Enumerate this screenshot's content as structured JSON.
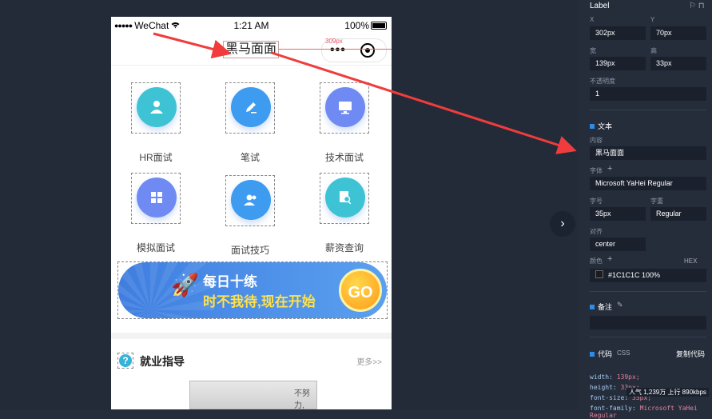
{
  "statusbar": {
    "carrier": "WeChat",
    "time": "1:21 AM",
    "battery": "100%"
  },
  "navbar": {
    "title": "黑马面面",
    "more": "•••",
    "measure": "309px"
  },
  "grid": {
    "items": [
      {
        "label": "HR面试",
        "icon": "user-icon",
        "color": "#3ec3d5"
      },
      {
        "label": "笔试",
        "icon": "pen-icon",
        "color": "#3d9bf0"
      },
      {
        "label": "技术面试",
        "icon": "monitor-icon",
        "color": "#6f8af2"
      },
      {
        "label": "模拟面试",
        "icon": "grid-icon",
        "color": "#6f8af2"
      },
      {
        "label": "面试技巧",
        "icon": "people-icon",
        "color": "#3d9bf0"
      },
      {
        "label": "薪资查询",
        "icon": "search-doc-icon",
        "color": "#3ec3d5"
      }
    ]
  },
  "banner": {
    "line1": "每日十练",
    "line2": "时不我待,现在开始",
    "go": "GO"
  },
  "section": {
    "title": "就业指导",
    "more": "更多>>",
    "photo_text": "不努力,"
  },
  "panel": {
    "title": "Label",
    "x_label": "X",
    "x_value": "302px",
    "y_label": "Y",
    "y_value": "70px",
    "w_label": "宽",
    "w_value": "139px",
    "h_label": "高",
    "h_value": "33px",
    "opacity_label": "不透明度",
    "opacity_value": "1",
    "text_section": "文本",
    "content_label": "内容",
    "content_value": "黑马面面",
    "font_label": "字体",
    "font_value": "Microsoft YaHei Regular",
    "size_label": "字号",
    "size_value": "35px",
    "weight_label": "字重",
    "weight_value": "Regular",
    "align_label": "对齐",
    "align_value": "center",
    "color_label": "颜色",
    "color_format": "HEX",
    "color_value": "#1C1C1C  100%",
    "note_section": "备注",
    "code_section": "代码",
    "code_lang": "CSS",
    "copy_code": "复制代码",
    "code_lines": [
      {
        "prop": "width:",
        "val": "139px;"
      },
      {
        "prop": "height:",
        "val": "33px;"
      },
      {
        "prop": "font-size:",
        "val": "35px;"
      },
      {
        "prop": "font-family:",
        "val": "Microsoft YaHei Regular"
      }
    ],
    "stats": "人气 1,239万  上行 890kbps"
  },
  "accent": "#2c8ce8",
  "arrow_color": "#f03c3c"
}
